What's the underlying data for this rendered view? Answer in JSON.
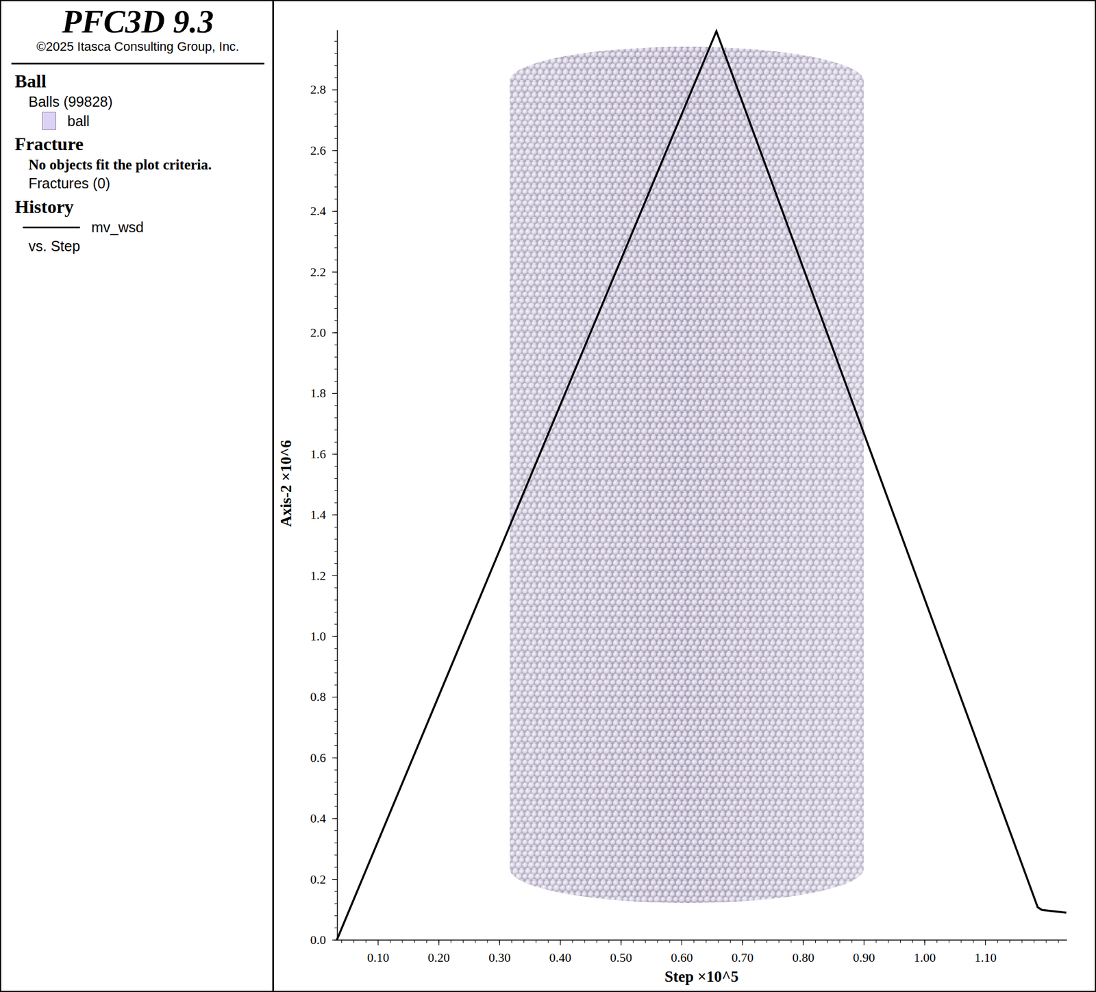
{
  "header": {
    "title": "PFC3D 9.3",
    "copyright": "©2025 Itasca Consulting Group, Inc."
  },
  "legend": [
    {
      "heading": "Ball",
      "items": [
        {
          "kind": "text",
          "text": "Balls (99828)"
        },
        {
          "kind": "swatch",
          "text": "ball",
          "color": "#dcd2f4"
        }
      ]
    },
    {
      "heading": "Fracture",
      "items": [
        {
          "kind": "note",
          "text": "No objects fit the plot criteria."
        },
        {
          "kind": "text",
          "text": "Fractures (0)"
        }
      ]
    },
    {
      "heading": "History",
      "items": [
        {
          "kind": "line",
          "text": "mv_wsd"
        },
        {
          "kind": "text",
          "text": "vs. Step"
        }
      ]
    }
  ],
  "chart": {
    "y_axis": {
      "title": "Axis-2 ×10^6",
      "ticks": [
        "0.0",
        "0.2",
        "0.4",
        "0.6",
        "0.8",
        "1.0",
        "1.2",
        "1.4",
        "1.6",
        "1.8",
        "2.0",
        "2.2",
        "2.4",
        "2.6",
        "2.8"
      ]
    },
    "x_axis": {
      "title": "Step ×10^5",
      "ticks": [
        "0.10",
        "0.20",
        "0.30",
        "0.40",
        "0.50",
        "0.60",
        "0.70",
        "0.80",
        "0.90",
        "1.00",
        "1.10"
      ]
    },
    "series": [
      {
        "name": "mv_wsd",
        "steps": [
          0.032,
          0.657,
          1.186,
          1.193,
          1.233
        ],
        "values": [
          0.0,
          2.993,
          0.108,
          0.099,
          0.09
        ]
      }
    ]
  }
}
